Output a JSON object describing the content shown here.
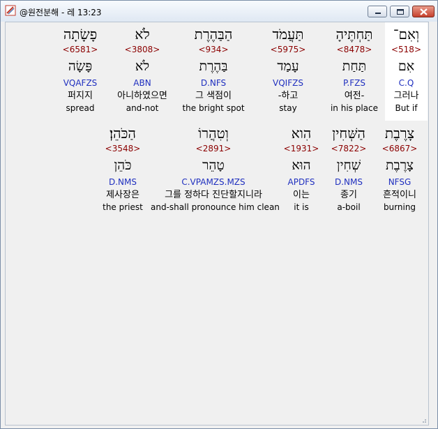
{
  "window": {
    "title": "@원전분해 - 레 13:23"
  },
  "rows": [
    [
      {
        "hebrew": "וְאִם־",
        "strongs": "<518>",
        "lemma": "אִם",
        "morph": "C.Q",
        "korean": "그러나",
        "english": "But if",
        "highlight": true
      },
      {
        "hebrew": "תַּחְתֶּיהָ",
        "strongs": "<8478>",
        "lemma": "תַּחַת",
        "morph": "P.FZS",
        "korean": "여전-",
        "english": "in his place"
      },
      {
        "hebrew": "תַּעֲמֹד",
        "strongs": "<5975>",
        "lemma": "עָמַד",
        "morph": "VQIFZS",
        "korean": "-하고",
        "english": "stay"
      },
      {
        "hebrew": "הַבַּהֶרֶת",
        "strongs": "<934>",
        "lemma": "בַּהֶרֶת",
        "morph": "D.NFS",
        "korean": "그 색점이",
        "english": "the bright spot"
      },
      {
        "hebrew": "לֹא",
        "strongs": "<3808>",
        "lemma": "לֹא",
        "morph": "ABN",
        "korean": "아니하였으면",
        "english": "and-not"
      },
      {
        "hebrew": "פָשָׂתָה",
        "strongs": "<6581>",
        "lemma": "פָּשָׂה",
        "morph": "VQAFZS",
        "korean": "퍼지지",
        "english": "spread"
      }
    ],
    [
      {
        "hebrew": "צָרֶבֶת",
        "strongs": "<6867>",
        "lemma": "צָרֶבֶת",
        "morph": "NFSG",
        "korean": "흔적이니",
        "english": "burning"
      },
      {
        "hebrew": "הַשְּׁחִין",
        "strongs": "<7822>",
        "lemma": "שְׁחִין",
        "morph": "D.NMS",
        "korean": "종기",
        "english": "a-boil"
      },
      {
        "hebrew": "הִוא",
        "strongs": "<1931>",
        "lemma": "הוּא",
        "morph": "APDFS",
        "korean": "이는",
        "english": "it is"
      },
      {
        "hebrew": "וְטִהֲרוֹ",
        "strongs": "<2891>",
        "lemma": "טָהֵר",
        "morph": "C.VPAMZS.MZS",
        "korean": "그를 정하다 진단할지니라",
        "english": "and-shall pronounce him clean"
      },
      {
        "hebrew": "הַכֹּהֵן׃",
        "strongs": "<3548>",
        "lemma": "כֹּהֵן",
        "morph": "D.NMS",
        "korean": "제사장은",
        "english": "the priest"
      }
    ]
  ]
}
